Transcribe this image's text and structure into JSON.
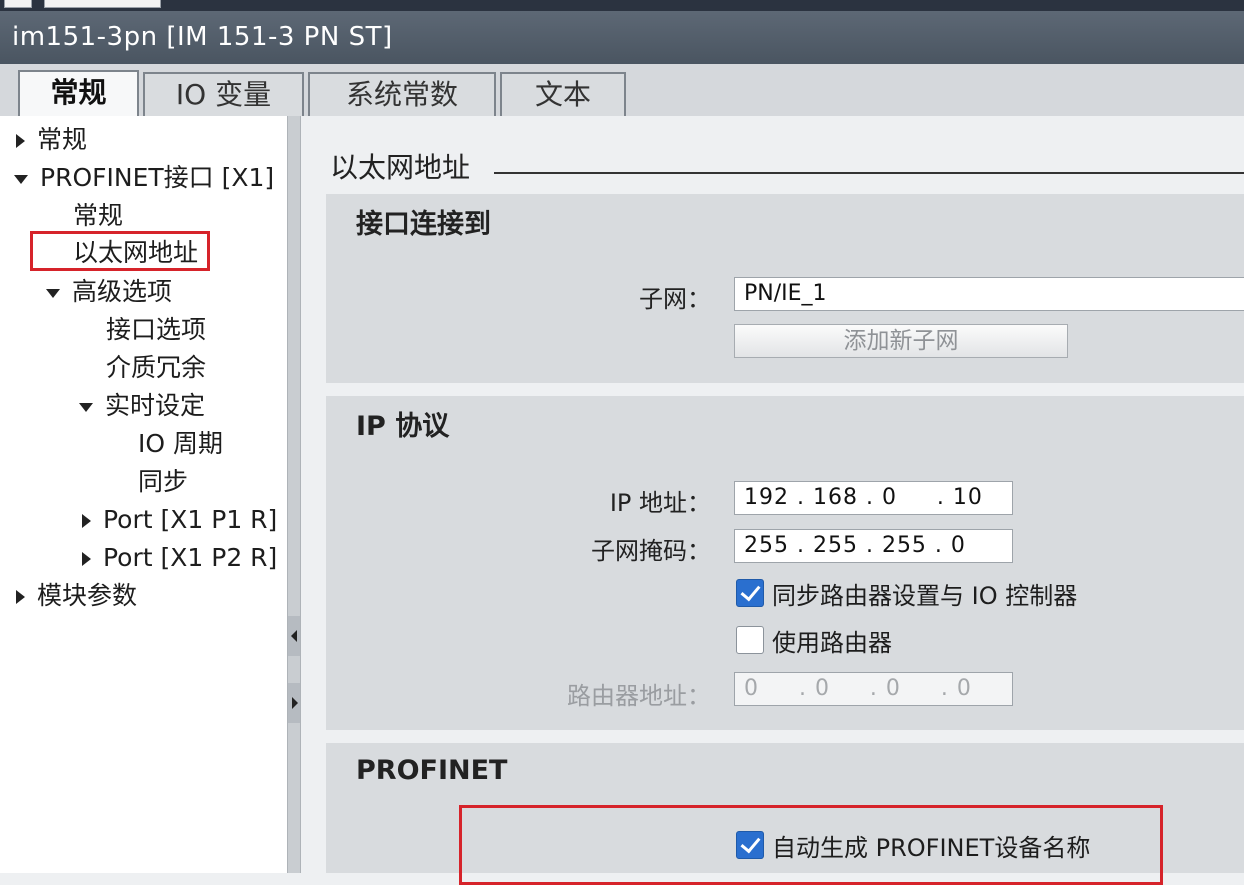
{
  "window": {
    "title": "im151-3pn [IM 151-3 PN ST]"
  },
  "tabs": [
    {
      "label": "常规",
      "active": true
    },
    {
      "label": "IO 变量",
      "active": false
    },
    {
      "label": "系统常数",
      "active": false
    },
    {
      "label": "文本",
      "active": false
    }
  ],
  "tree": {
    "general": "常规",
    "profinet_interface": "PROFINET接口 [X1]",
    "pn_general": "常规",
    "ethernet_address": "以太网地址",
    "advanced_options": "高级选项",
    "interface_options": "接口选项",
    "media_redundancy": "介质冗余",
    "realtime_settings": "实时设定",
    "io_cycle": "IO 周期",
    "sync": "同步",
    "port1": "Port [X1 P1 R]",
    "port2": "Port [X1 P2 R]",
    "module_params": "模块参数"
  },
  "main": {
    "heading": "以太网地址",
    "interface_section": {
      "title": "接口连接到",
      "subnet_label": "子网：",
      "subnet_value": "PN/IE_1",
      "add_subnet_button": "添加新子网"
    },
    "ip_section": {
      "title": "IP 协议",
      "ip_label": "IP 地址：",
      "ip_value": "192 . 168 . 0     . 10",
      "mask_label": "子网掩码：",
      "mask_value": "255 . 255 . 255 . 0",
      "sync_router_label": "同步路由器设置与 IO 控制器",
      "sync_router_checked": true,
      "use_router_label": "使用路由器",
      "use_router_checked": false,
      "router_addr_label": "路由器地址：",
      "router_addr_value": "0     . 0     . 0     . 0"
    },
    "profinet_section": {
      "title": "PROFINET",
      "auto_name_label": "自动生成 PROFINET设备名称",
      "auto_name_checked": true
    }
  },
  "colors": {
    "highlight": "#d6232a",
    "checkbox_checked": "#2a6fcf",
    "titlebar": "#4f5a66"
  }
}
